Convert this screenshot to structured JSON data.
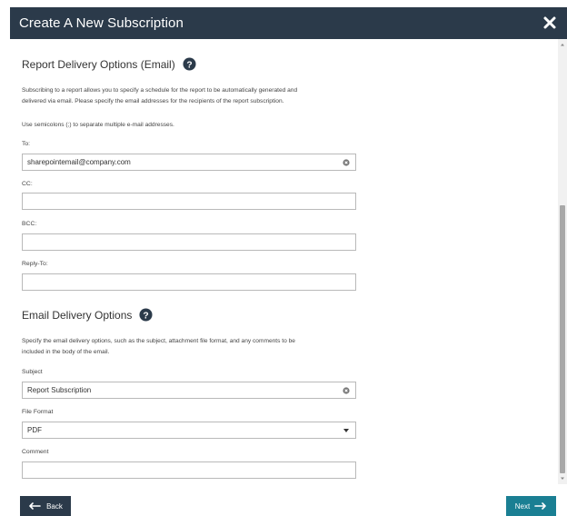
{
  "dialog": {
    "title": "Create A New Subscription"
  },
  "report_delivery": {
    "heading": "Report Delivery Options (Email)",
    "description_line1": "Subscribing to a report allows you to specify a schedule for the report to be automatically generated and",
    "description_line2": "delivered via email.  Please specify the email addresses for the recipients of the report subscription.",
    "semicolon_note": "Use semicolons (;) to separate multiple e-mail addresses.",
    "to_label": "To:",
    "to_value": "sharepointemail@company.com",
    "cc_label": "CC:",
    "cc_value": "",
    "bcc_label": "BCC:",
    "bcc_value": "",
    "reply_to_label": "Reply-To:",
    "reply_to_value": ""
  },
  "email_delivery": {
    "heading": "Email Delivery Options",
    "description_line1": "Specify the email delivery options, such as the subject, attachment file format, and any comments to be",
    "description_line2": "included in the body of the email.",
    "subject_label": "Subject",
    "subject_value": "Report Subscription",
    "file_format_label": "File Format",
    "file_format_value": "PDF",
    "comment_label": "Comment",
    "comment_value": ""
  },
  "footer": {
    "back_label": "Back",
    "next_label": "Next"
  },
  "colors": {
    "header_bg": "#2b3a4a",
    "next_bg": "#1a7f93"
  }
}
